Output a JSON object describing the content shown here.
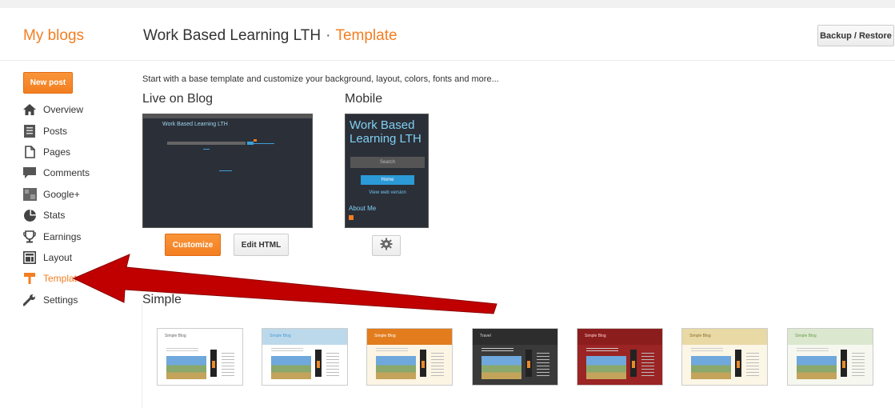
{
  "header": {
    "my_blogs": "My blogs",
    "blog_name": "Work Based Learning LTH",
    "separator": "·",
    "current_page": "Template",
    "backup_restore": "Backup / Restore"
  },
  "sidebar": {
    "new_post": "New post",
    "items": [
      {
        "label": "Overview",
        "icon": "home-icon"
      },
      {
        "label": "Posts",
        "icon": "posts-icon"
      },
      {
        "label": "Pages",
        "icon": "pages-icon"
      },
      {
        "label": "Comments",
        "icon": "comments-icon"
      },
      {
        "label": "Google+",
        "icon": "google-plus-icon"
      },
      {
        "label": "Stats",
        "icon": "stats-icon"
      },
      {
        "label": "Earnings",
        "icon": "trophy-icon"
      },
      {
        "label": "Layout",
        "icon": "layout-icon"
      },
      {
        "label": "Template",
        "icon": "template-icon",
        "active": true
      },
      {
        "label": "Settings",
        "icon": "wrench-icon"
      }
    ]
  },
  "main": {
    "intro": "Start with a base template and customize your background, layout, colors, fonts and more...",
    "live_heading": "Live on Blog",
    "mobile_heading": "Mobile",
    "live_preview": {
      "title": "Work Based Learning LTH"
    },
    "mobile_preview": {
      "title": "Work Based Learning LTH",
      "search_placeholder": "Search",
      "home": "Home",
      "view_web": "View web version",
      "about": "About Me"
    },
    "customize_button": "Customize",
    "edit_html_button": "Edit HTML",
    "simple_heading": "Simple",
    "themes": [
      {
        "title": "Simple Blog",
        "bar": "#ffffff",
        "body": "#ffffff",
        "title_color": "#666666"
      },
      {
        "title": "Simple Blog",
        "bar": "#bcd9ec",
        "body": "#ffffff",
        "title_color": "#4f9bd0"
      },
      {
        "title": "Simple Blog",
        "bar": "#e27c1c",
        "body": "#fdf5e4",
        "title_color": "#ffffff"
      },
      {
        "title": "Travel",
        "bar": "#2d2d2d",
        "body": "#3a3a3a",
        "title_color": "#dddddd"
      },
      {
        "title": "Simple Blog",
        "bar": "#8c1d1d",
        "body": "#9b2424",
        "title_color": "#ffcccc"
      },
      {
        "title": "Simple Blog",
        "bar": "#e9d9a4",
        "body": "#fbf6e6",
        "title_color": "#8a6d30"
      },
      {
        "title": "Simple Blog",
        "bar": "#dbe8cf",
        "body": "#f6f8ef",
        "title_color": "#6e9d4d"
      }
    ]
  },
  "colors": {
    "accent": "#f37e21",
    "arrow": "#c00000"
  }
}
